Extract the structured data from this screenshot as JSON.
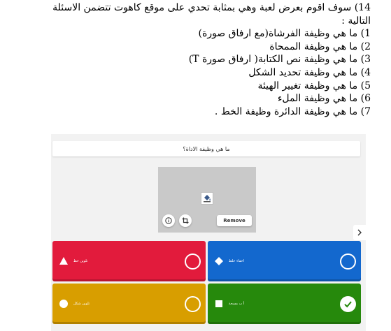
{
  "document": {
    "lines": [
      "14) سوف اقوم بعرض لعبة وهي بمثابة تحدي على موقع كاهوت تتضمن الاسئلة",
      "التالية :",
      "1) ما هي وظيفة الفرشاة(مع ارفاق صورة)",
      "2) ما هي وظيفة الممحاة",
      "3) ما هي وظيفة نص الكتابة( ارفاق صورة T)",
      "4) ما هي وظيفة تحديد الشكل",
      "5) ما هي وظيفة تغيير الهيئة",
      "6) ما هي وظيفة الملء",
      "7) ما هي وظيفة الدائرة وظيفة الخط ."
    ]
  },
  "kahoot": {
    "question": "ما هي وظيفة الاداة؟",
    "media": {
      "remove_label": "Remove",
      "icons": [
        "paint-bucket-icon",
        "info-icon",
        "crop-icon"
      ]
    },
    "answers": [
      {
        "text": "تلوين خط",
        "color": "#e21b3c",
        "shape": "triangle",
        "correct": false
      },
      {
        "text": "اخفاء خلط",
        "color": "#1368ce",
        "shape": "diamond",
        "correct": false
      },
      {
        "text": "تلوين شكل",
        "color": "#d89e00",
        "shape": "circle",
        "correct": false
      },
      {
        "text": "أ ب مسحة",
        "color": "#26890c",
        "shape": "square",
        "correct": true
      }
    ],
    "next_icon": "chevron-right-icon"
  }
}
